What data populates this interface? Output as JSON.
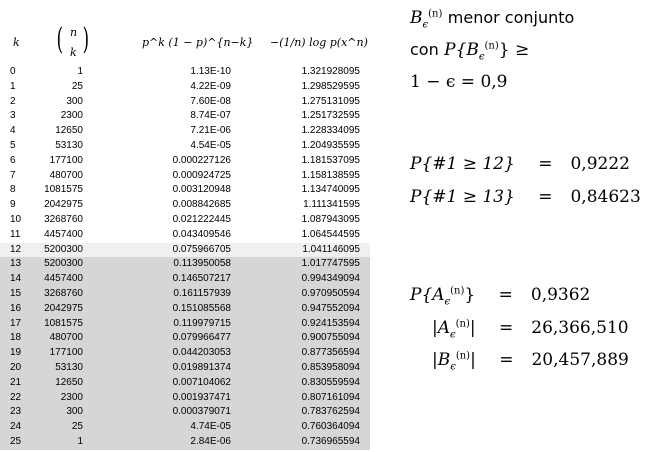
{
  "table": {
    "headers": {
      "k": "k",
      "binom_top": "n",
      "binom_bottom": "k",
      "prob": "p^k (1 − p)^{n−k}",
      "log": "−(1/n) log p(x^n)"
    },
    "rows": [
      {
        "k": "0",
        "n": "1",
        "p": "1.13E-10",
        "l": "1.321928095",
        "s": false,
        "m": false
      },
      {
        "k": "1",
        "n": "25",
        "p": "4.22E-09",
        "l": "1.298529595",
        "s": false,
        "m": false
      },
      {
        "k": "2",
        "n": "300",
        "p": "7.60E-08",
        "l": "1.275131095",
        "s": false,
        "m": false
      },
      {
        "k": "3",
        "n": "2300",
        "p": "8.74E-07",
        "l": "1.251732595",
        "s": false,
        "m": false
      },
      {
        "k": "4",
        "n": "12650",
        "p": "7.21E-06",
        "l": "1.228334095",
        "s": false,
        "m": false
      },
      {
        "k": "5",
        "n": "53130",
        "p": "4.54E-05",
        "l": "1.204935595",
        "s": false,
        "m": false
      },
      {
        "k": "6",
        "n": "177100",
        "p": "0.000227126",
        "l": "1.181537095",
        "s": false,
        "m": false
      },
      {
        "k": "7",
        "n": "480700",
        "p": "0.000924725",
        "l": "1.158138595",
        "s": false,
        "m": false
      },
      {
        "k": "8",
        "n": "1081575",
        "p": "0.003120948",
        "l": "1.134740095",
        "s": false,
        "m": false
      },
      {
        "k": "9",
        "n": "2042975",
        "p": "0.008842685",
        "l": "1.111341595",
        "s": false,
        "m": false
      },
      {
        "k": "10",
        "n": "3268760",
        "p": "0.021222445",
        "l": "1.087943095",
        "s": false,
        "m": false
      },
      {
        "k": "11",
        "n": "4457400",
        "p": "0.043409546",
        "l": "1.064544595",
        "s": false,
        "m": false
      },
      {
        "k": "12",
        "n": "5200300",
        "p": "0.075966705",
        "l": "1.041146095",
        "s": false,
        "m": true
      },
      {
        "k": "13",
        "n": "5200300",
        "p": "0.113950058",
        "l": "1.017747595",
        "s": true,
        "m": false
      },
      {
        "k": "14",
        "n": "4457400",
        "p": "0.146507217",
        "l": "0.994349094",
        "s": true,
        "m": false
      },
      {
        "k": "15",
        "n": "3268760",
        "p": "0.161157939",
        "l": "0.970950594",
        "s": true,
        "m": false
      },
      {
        "k": "16",
        "n": "2042975",
        "p": "0.151085568",
        "l": "0.947552094",
        "s": true,
        "m": false
      },
      {
        "k": "17",
        "n": "1081575",
        "p": "0.119979715",
        "l": "0.924153594",
        "s": true,
        "m": false
      },
      {
        "k": "18",
        "n": "480700",
        "p": "0.079966477",
        "l": "0.900755094",
        "s": true,
        "m": false
      },
      {
        "k": "19",
        "n": "177100",
        "p": "0.044203053",
        "l": "0.877356594",
        "s": true,
        "m": false
      },
      {
        "k": "20",
        "n": "53130",
        "p": "0.019891374",
        "l": "0.853958094",
        "s": true,
        "m": false
      },
      {
        "k": "21",
        "n": "12650",
        "p": "0.007104062",
        "l": "0.830559594",
        "s": true,
        "m": false
      },
      {
        "k": "22",
        "n": "2300",
        "p": "0.001937471",
        "l": "0.807161094",
        "s": true,
        "m": false
      },
      {
        "k": "23",
        "n": "300",
        "p": "0.000379071",
        "l": "0.783762594",
        "s": true,
        "m": false
      },
      {
        "k": "24",
        "n": "25",
        "p": "4.74E-05",
        "l": "0.760364094",
        "s": true,
        "m": false
      },
      {
        "k": "25",
        "n": "1",
        "p": "2.84E-06",
        "l": "0.736965594",
        "s": true,
        "m": false
      }
    ]
  },
  "notes": {
    "b_symbol": "B",
    "menor": "menor conjunto",
    "con": "con",
    "cond": "P{B",
    "ge": "} ≥",
    "eq": "1 − ϵ = 0,9",
    "p12_lhs": "P{#1 ≥ 12}",
    "p12_val": "0,9222",
    "p13_lhs": "P{#1 ≥ 13}",
    "p13_val": "0,84623",
    "pa_lhs": "P{A",
    "pa_val": "0,9362",
    "a_size_val": "26,366,510",
    "b_size_val": "20,457,889",
    "eqsign": "="
  }
}
